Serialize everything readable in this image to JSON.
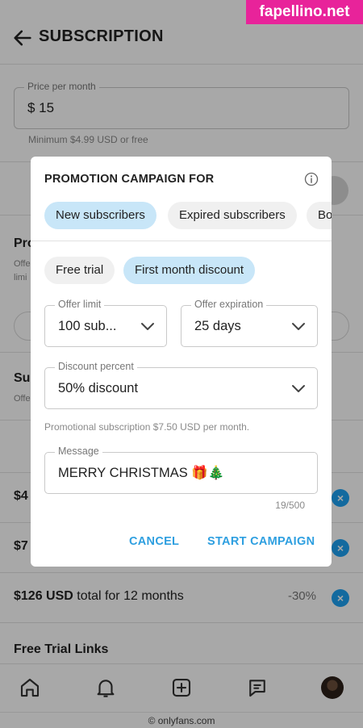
{
  "header": {
    "title": "SUBSCRIPTION"
  },
  "price": {
    "label": "Price per month",
    "value": "$ 15",
    "hint": "Minimum $4.99 USD or free"
  },
  "background": {
    "section1_title": "Pro",
    "section1_sub": "Offe",
    "section1_sub2": "limi",
    "section2_title": "Su",
    "section2_sub": "Offe"
  },
  "bundles": [
    {
      "price": "$4",
      "rest": "",
      "pct": ""
    },
    {
      "price": "$7",
      "rest": "",
      "pct": ""
    },
    {
      "price": "$126 USD",
      "rest": " total for 12 months",
      "pct": "-30%"
    }
  ],
  "free_trial_title": "Free Trial Links",
  "url": "© onlyfans.com",
  "watermark": "fapellino.net",
  "modal": {
    "title": "PROMOTION CAMPAIGN FOR",
    "audience_tabs": [
      {
        "label": "New subscribers",
        "active": true
      },
      {
        "label": "Expired subscribers",
        "active": false
      },
      {
        "label": "Bo",
        "active": false
      }
    ],
    "type_tabs": [
      {
        "label": "Free trial",
        "active": false
      },
      {
        "label": "First month discount",
        "active": true
      }
    ],
    "offer_limit": {
      "label": "Offer limit",
      "value": "100 sub..."
    },
    "offer_expiration": {
      "label": "Offer expiration",
      "value": "25 days"
    },
    "discount": {
      "label": "Discount percent",
      "value": "50% discount"
    },
    "hint": "Promotional subscription $7.50 USD per month.",
    "message": {
      "label": "Message",
      "value": "MERRY CHRISTMAS 🎁🎄"
    },
    "counter": "19/500",
    "cancel": "CANCEL",
    "start": "START CAMPAIGN"
  },
  "colors": {
    "accent": "#2e9fe0",
    "chip_active": "#c8e6f8",
    "chip_inactive": "#f0f0f0",
    "watermark": "#e8239a"
  }
}
